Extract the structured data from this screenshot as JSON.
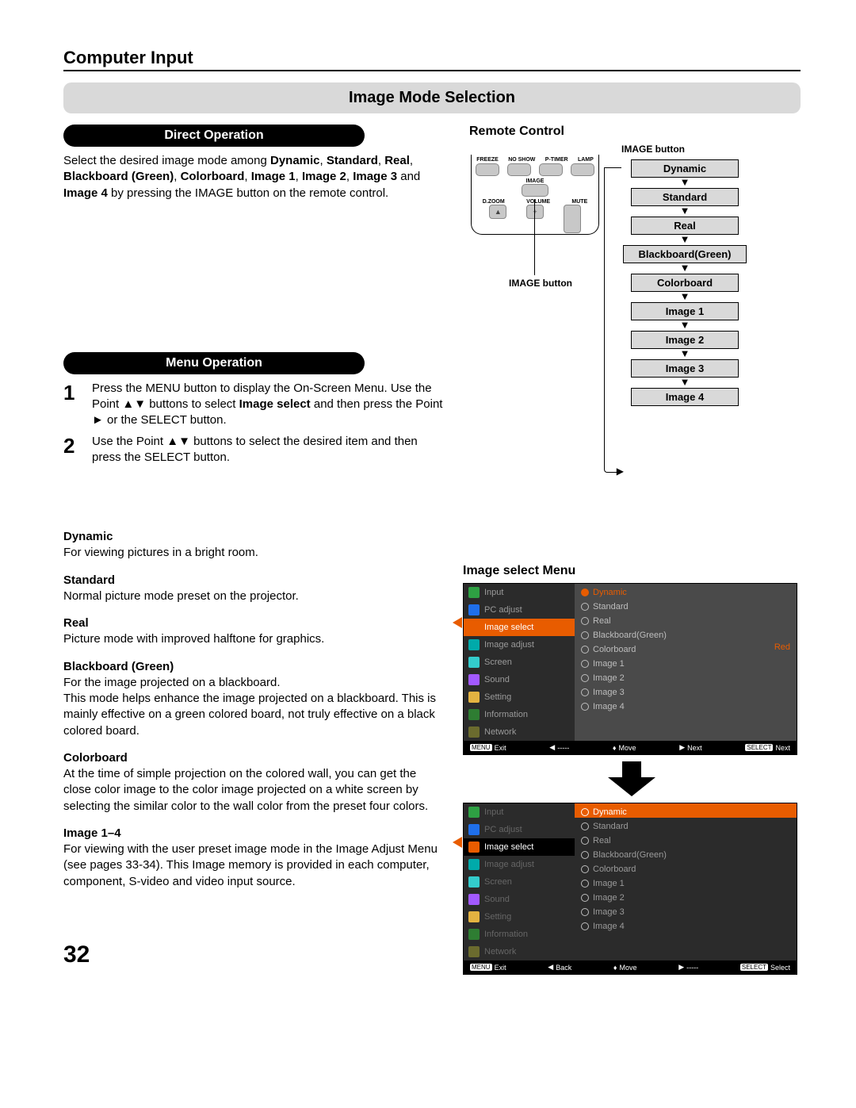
{
  "section_title": "Computer Input",
  "banner": "Image Mode Selection",
  "direct_operation": {
    "heading": "Direct Operation",
    "text_parts": {
      "p1": "Select the desired image mode among ",
      "b1": "Dynamic",
      "c1": ", ",
      "b2": "Standard",
      "c2": ", ",
      "b3": "Real",
      "c3": ", ",
      "b4": "Blackboard (Green)",
      "c4": ", ",
      "b5": "Colorboard",
      "c5": ", ",
      "b6": "Image 1",
      "c6": ", ",
      "b7": "Image 2",
      "c7": ", ",
      "b8": "Image 3",
      "c8": " and ",
      "b9": "Image 4",
      "p2": " by pressing the IMAGE button on the remote control."
    }
  },
  "menu_operation": {
    "heading": "Menu Operation",
    "step1": "Press the MENU button to display the On-Screen Menu. Use the Point ▲▼ buttons to select Image select and then press the Point ► or the SELECT button.",
    "step2": "Use the Point ▲▼ buttons to select  the desired item and then press the SELECT button.",
    "num1": "1",
    "num2": "2"
  },
  "remote": {
    "title": "Remote Control",
    "labels_top": [
      "FREEZE",
      "NO SHOW",
      "P-TIMER",
      "LAMP"
    ],
    "mid": "IMAGE",
    "labels_bot": [
      "D.ZOOM",
      "VOLUME",
      "MUTE"
    ],
    "image_button": "IMAGE button",
    "image_button2": "IMAGE button"
  },
  "flow": [
    "Dynamic",
    "Standard",
    "Real",
    "Blackboard(Green)",
    "Colorboard",
    "Image 1",
    "Image 2",
    "Image 3",
    "Image 4"
  ],
  "descriptions": {
    "dynamic": {
      "t": "Dynamic",
      "d": "For viewing pictures in a bright room."
    },
    "standard": {
      "t": "Standard",
      "d": "Normal picture mode preset on the projector."
    },
    "real": {
      "t": "Real",
      "d": "Picture mode with improved halftone for graphics."
    },
    "blackboard": {
      "t": "Blackboard (Green)",
      "d": "For the image projected on a blackboard.\nThis mode helps enhance the image projected on a blackboard. This is mainly effective on a green colored board, not truly effective on a black colored board."
    },
    "colorboard": {
      "t": "Colorboard",
      "d": "At the time of simple projection on the colored wall, you can get the close color image to the color image projected on a white screen by selecting the similar color to the wall color from the preset four colors."
    },
    "image14": {
      "t": "Image 1–4",
      "d": "For viewing with the user preset image mode in the Image Adjust Menu (see pages 33-34). This Image memory is provided in each computer, component, S-video and video input source."
    }
  },
  "image_select_title": "Image select Menu",
  "osd_menu": {
    "items": [
      "Input",
      "PC adjust",
      "Image select",
      "Image adjust",
      "Screen",
      "Sound",
      "Setting",
      "Information",
      "Network"
    ],
    "options": [
      "Dynamic",
      "Standard",
      "Real",
      "Blackboard(Green)",
      "Colorboard",
      "Image 1",
      "Image 2",
      "Image 3",
      "Image 4"
    ],
    "red_label": "Red",
    "footer1": {
      "exit": "Exit",
      "c2": "-----",
      "move": "Move",
      "next": "Next",
      "select": "Next"
    },
    "footer2": {
      "exit": "Exit",
      "back": "Back",
      "move": "Move",
      "c4": "-----",
      "select": "Select"
    },
    "kb_menu": "MENU",
    "kb_select": "SELECT"
  },
  "page_number": "32"
}
